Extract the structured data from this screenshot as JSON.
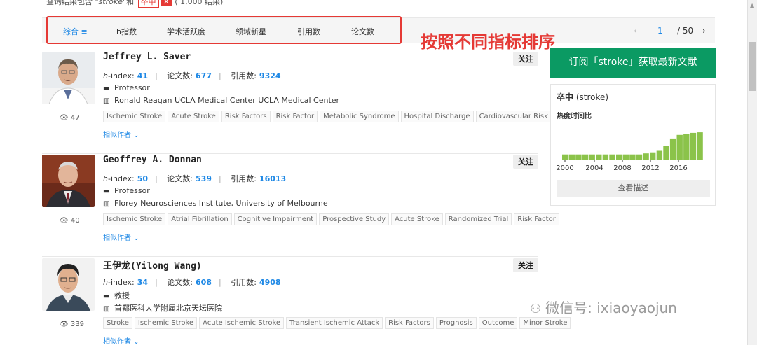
{
  "top_line": {
    "prefix": "查询结果包含",
    "query": "\"stroke\"",
    "and": "和",
    "tag": "卒中",
    "tag_close": "✕",
    "count": "( 1,000 结果)"
  },
  "sort": {
    "items": [
      "综合 ≡",
      "h指数",
      "学术活跃度",
      "领域新星",
      "引用数",
      "论文数"
    ],
    "active_index": 0
  },
  "annotation": "按照不同指标排序",
  "pager": {
    "prev": "‹",
    "current": "1",
    "total": "/ 50",
    "next": "›"
  },
  "labels": {
    "hindex": "h",
    "hindex_suffix": "-index:",
    "papers": "论文数:",
    "citations": "引用数:",
    "follow": "关注",
    "similar": "相似作者 ⌄"
  },
  "authors": [
    {
      "name": "Jeffrey L. Saver",
      "hindex": "41",
      "papers": "677",
      "citations": "9324",
      "position": "Professor",
      "affiliation": "Ronald Reagan UCLA Medical Center UCLA Medical Center",
      "views": "47",
      "tags": [
        "Ischemic Stroke",
        "Acute Stroke",
        "Risk Factors",
        "Risk Factor",
        "Metabolic Syndrome",
        "Hospital Discharge",
        "Cardiovascular Risk"
      ]
    },
    {
      "name": "Geoffrey A. Donnan",
      "hindex": "50",
      "papers": "539",
      "citations": "16013",
      "position": "Professor",
      "affiliation": "Florey Neurosciences Institute, University of Melbourne",
      "views": "40",
      "tags": [
        "Ischemic Stroke",
        "Atrial Fibrillation",
        "Cognitive Impairment",
        "Prospective Study",
        "Acute Stroke",
        "Randomized Trial",
        "Risk Factor"
      ]
    },
    {
      "name": "王伊龙(Yilong Wang)",
      "hindex": "34",
      "papers": "608",
      "citations": "4908",
      "position": "教授",
      "affiliation": "首都医科大学附属北京天坛医院",
      "views": "339",
      "tags": [
        "Stroke",
        "Ischemic Stroke",
        "Acute Ischemic Stroke",
        "Transient Ischemic Attack",
        "Risk Factors",
        "Prognosis",
        "Outcome",
        "Minor Stroke"
      ]
    }
  ],
  "sidebar": {
    "subscribe": "订阅「stroke」获取最新文献",
    "trend_title_bold": "卒中",
    "trend_title_rest": " (stroke)",
    "trend_subtitle": "热度时间比",
    "describe_button": "查看描述"
  },
  "chart_data": {
    "type": "bar",
    "x_ticks": [
      "2000",
      "2004",
      "2008",
      "2012",
      "2016"
    ],
    "values": [
      1,
      1,
      1,
      1,
      1,
      1,
      1,
      1,
      1,
      1,
      1,
      1,
      1.2,
      1.4,
      1.7,
      2.6,
      4.1,
      4.8,
      5.0,
      5.2,
      5.3
    ],
    "color": "#8bc34a",
    "ylim": [
      0,
      6
    ]
  },
  "watermark": "微信号: ixiaoyaojun",
  "colors": {
    "accent": "#1e88e5",
    "highlight": "#e53935",
    "subscribe": "#0b9a63",
    "bar": "#8bc34a"
  }
}
